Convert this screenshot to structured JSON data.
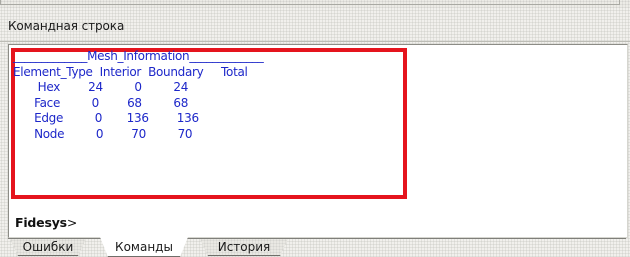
{
  "panel": {
    "title": "Командная строка"
  },
  "console": {
    "output_lines": [
      "_____________Mesh_Information_____________",
      "Element_Type  Interior  Boundary     Total",
      "       Hex        24         0         24",
      "      Face         0        68         68",
      "      Edge         0       136        136",
      "      Node         0        70         70"
    ],
    "prompt": "Fidesys",
    "prompt_symbol": ">"
  },
  "tabs": [
    {
      "label": "Ошибки",
      "active": false
    },
    {
      "label": "Команды",
      "active": true
    },
    {
      "label": "История",
      "active": false
    }
  ],
  "colors": {
    "output_text": "#1d27c9",
    "highlight_border": "#e5141d",
    "background": "#ecebe6",
    "console_bg": "#ffffff"
  }
}
